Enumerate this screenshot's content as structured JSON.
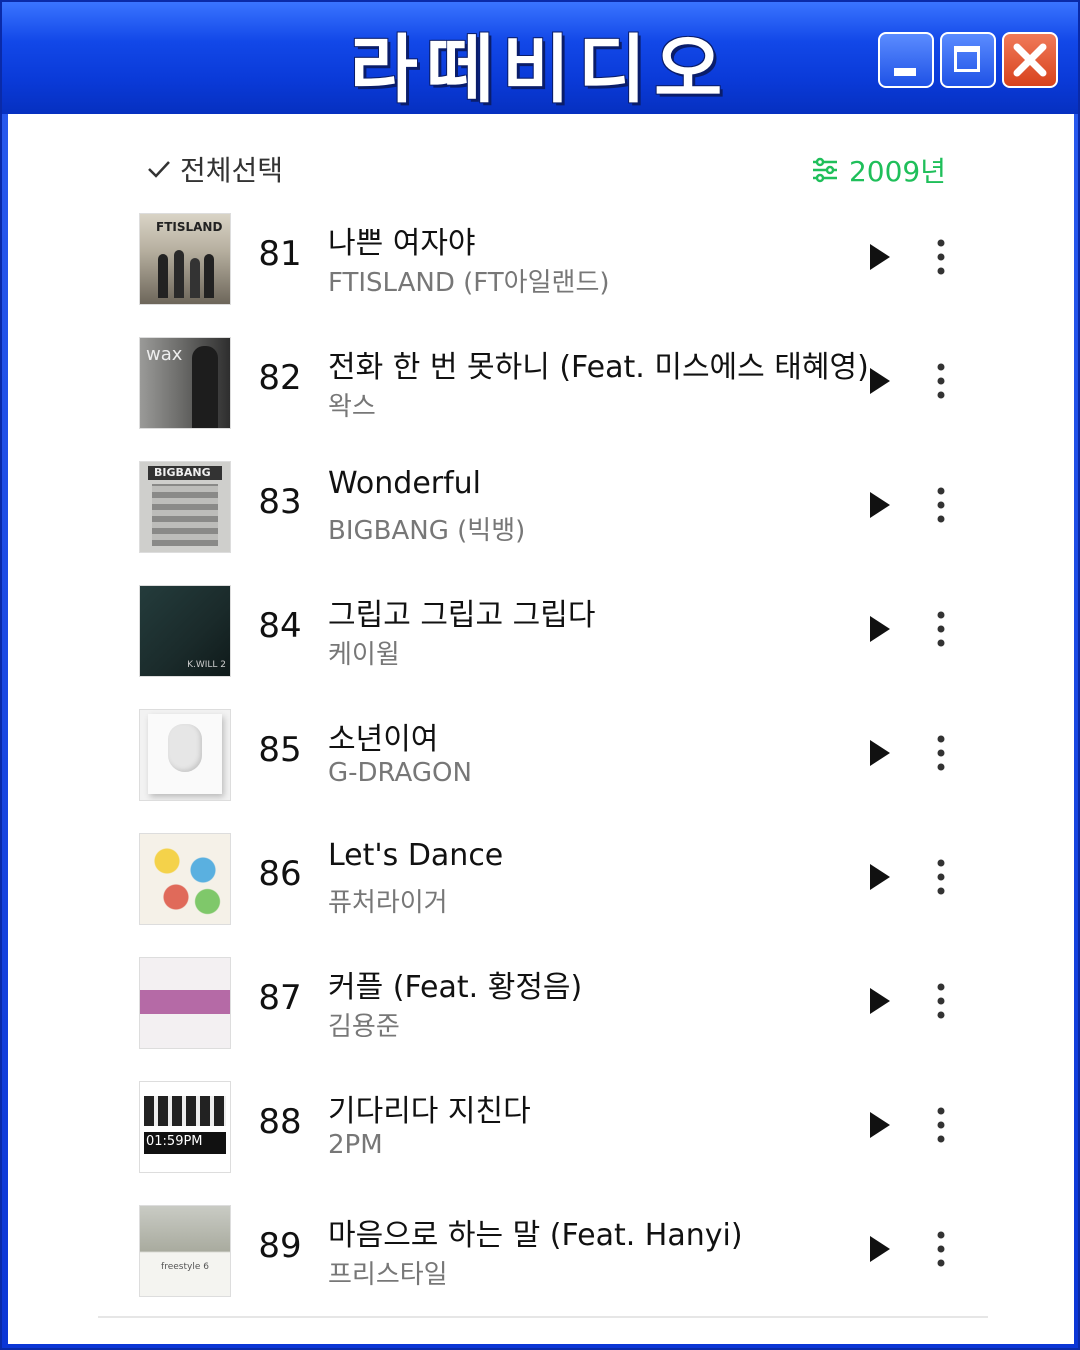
{
  "window": {
    "title": "라떼비디오",
    "controls": {
      "minimize_icon": "minimize-icon",
      "maximize_icon": "maximize-icon",
      "close_icon": "close-icon"
    }
  },
  "header": {
    "select_all_label": "전체선택",
    "year_filter_label": "2009년",
    "accent_color": "#1fbf5a"
  },
  "tracks": [
    {
      "rank": "81",
      "title": "나쁜 여자야",
      "artist": "FTISLAND (FT아일랜드)",
      "art_text": "FTISLAND"
    },
    {
      "rank": "82",
      "title": "전화 한 번 못하니 (Feat. 미스에스 태혜영)",
      "artist": "왁스",
      "art_text": "wax"
    },
    {
      "rank": "83",
      "title": "Wonderful",
      "artist": "BIGBANG (빅뱅)",
      "art_text": "BIGBANG"
    },
    {
      "rank": "84",
      "title": "그립고 그립고 그립다",
      "artist": "케이윌",
      "art_text": "K.WILL 2"
    },
    {
      "rank": "85",
      "title": "소년이여",
      "artist": "G-DRAGON",
      "art_text": ""
    },
    {
      "rank": "86",
      "title": "Let's Dance",
      "artist": "퓨처라이거",
      "art_text": ""
    },
    {
      "rank": "87",
      "title": "커플 (Feat. 황정음)",
      "artist": "김용준",
      "art_text": ""
    },
    {
      "rank": "88",
      "title": "기다리다 지친다",
      "artist": "2PM",
      "art_text": "01:59PM"
    },
    {
      "rank": "89",
      "title": "마음으로 하는 말 (Feat. Hanyi)",
      "artist": "프리스타일",
      "art_text": "freestyle 6"
    }
  ]
}
